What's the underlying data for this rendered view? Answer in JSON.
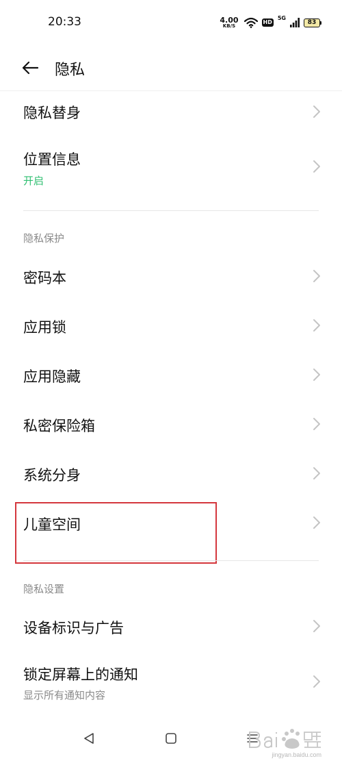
{
  "status_bar": {
    "time": "20:33",
    "net_speed_value": "4.00",
    "net_speed_unit": "KB/S",
    "hd_label": "HD",
    "network_type": "5G",
    "battery_level": "83",
    "icons": [
      "wifi-icon",
      "hd-icon",
      "signal-icon",
      "battery-icon"
    ]
  },
  "header": {
    "title": "隐私",
    "back_icon": "arrow-left-icon"
  },
  "items_top": [
    {
      "label": "隐私替身"
    },
    {
      "label": "位置信息",
      "sub": "开启"
    }
  ],
  "section_protection": {
    "title": "隐私保护",
    "items": [
      {
        "label": "密码本"
      },
      {
        "label": "应用锁"
      },
      {
        "label": "应用隐藏"
      },
      {
        "label": "私密保险箱"
      },
      {
        "label": "系统分身"
      },
      {
        "label": "儿童空间"
      }
    ]
  },
  "section_settings": {
    "title": "隐私设置",
    "items": [
      {
        "label": "设备标识与广告"
      },
      {
        "label": "锁定屏幕上的通知",
        "sub": "显示所有通知内容"
      }
    ]
  },
  "nav_bar": {
    "icons": [
      "back-triangle-icon",
      "home-square-icon",
      "menu-lines-icon"
    ]
  },
  "watermark": {
    "text": "jingyan.baidu.com"
  },
  "colors": {
    "accent_green": "#2fbf71",
    "highlight_red": "#d4363c",
    "secondary_text": "#8a8a8a",
    "chevron": "#c4c4c4"
  }
}
